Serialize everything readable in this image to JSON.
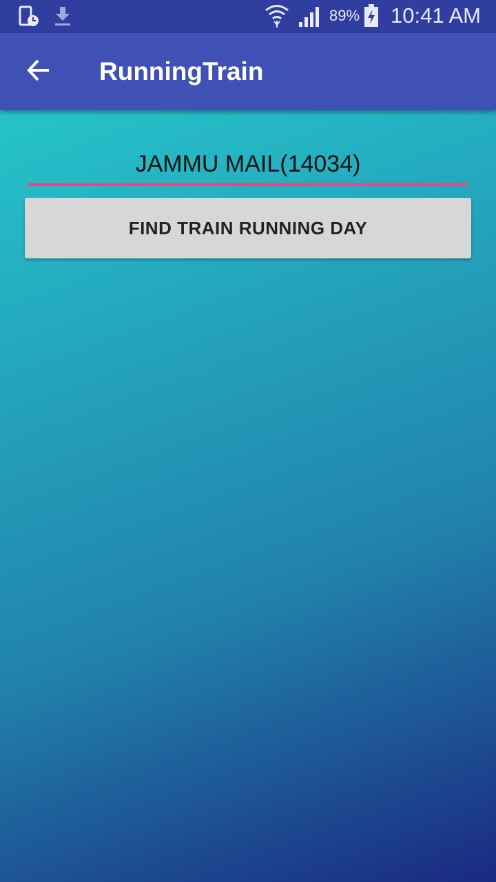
{
  "status_bar": {
    "battery_percent": "89%",
    "time": "10:41 AM",
    "icons": [
      "phone-clock-icon",
      "download-icon",
      "wifi-icon",
      "signal-icon",
      "battery-charging-icon"
    ]
  },
  "app_bar": {
    "title": "RunningTrain",
    "back_icon": "arrow-left-icon"
  },
  "form": {
    "train_value": "JAMMU MAIL(14034)",
    "find_button_label": "FIND TRAIN RUNNING DAY"
  },
  "colors": {
    "status_bar": "#303f9f",
    "app_bar": "#3f51b5",
    "field_underline": "#e04b86",
    "button_bg": "#d6d7d7",
    "gradient_top": "#26d0ce",
    "gradient_bottom": "#1a2980"
  }
}
